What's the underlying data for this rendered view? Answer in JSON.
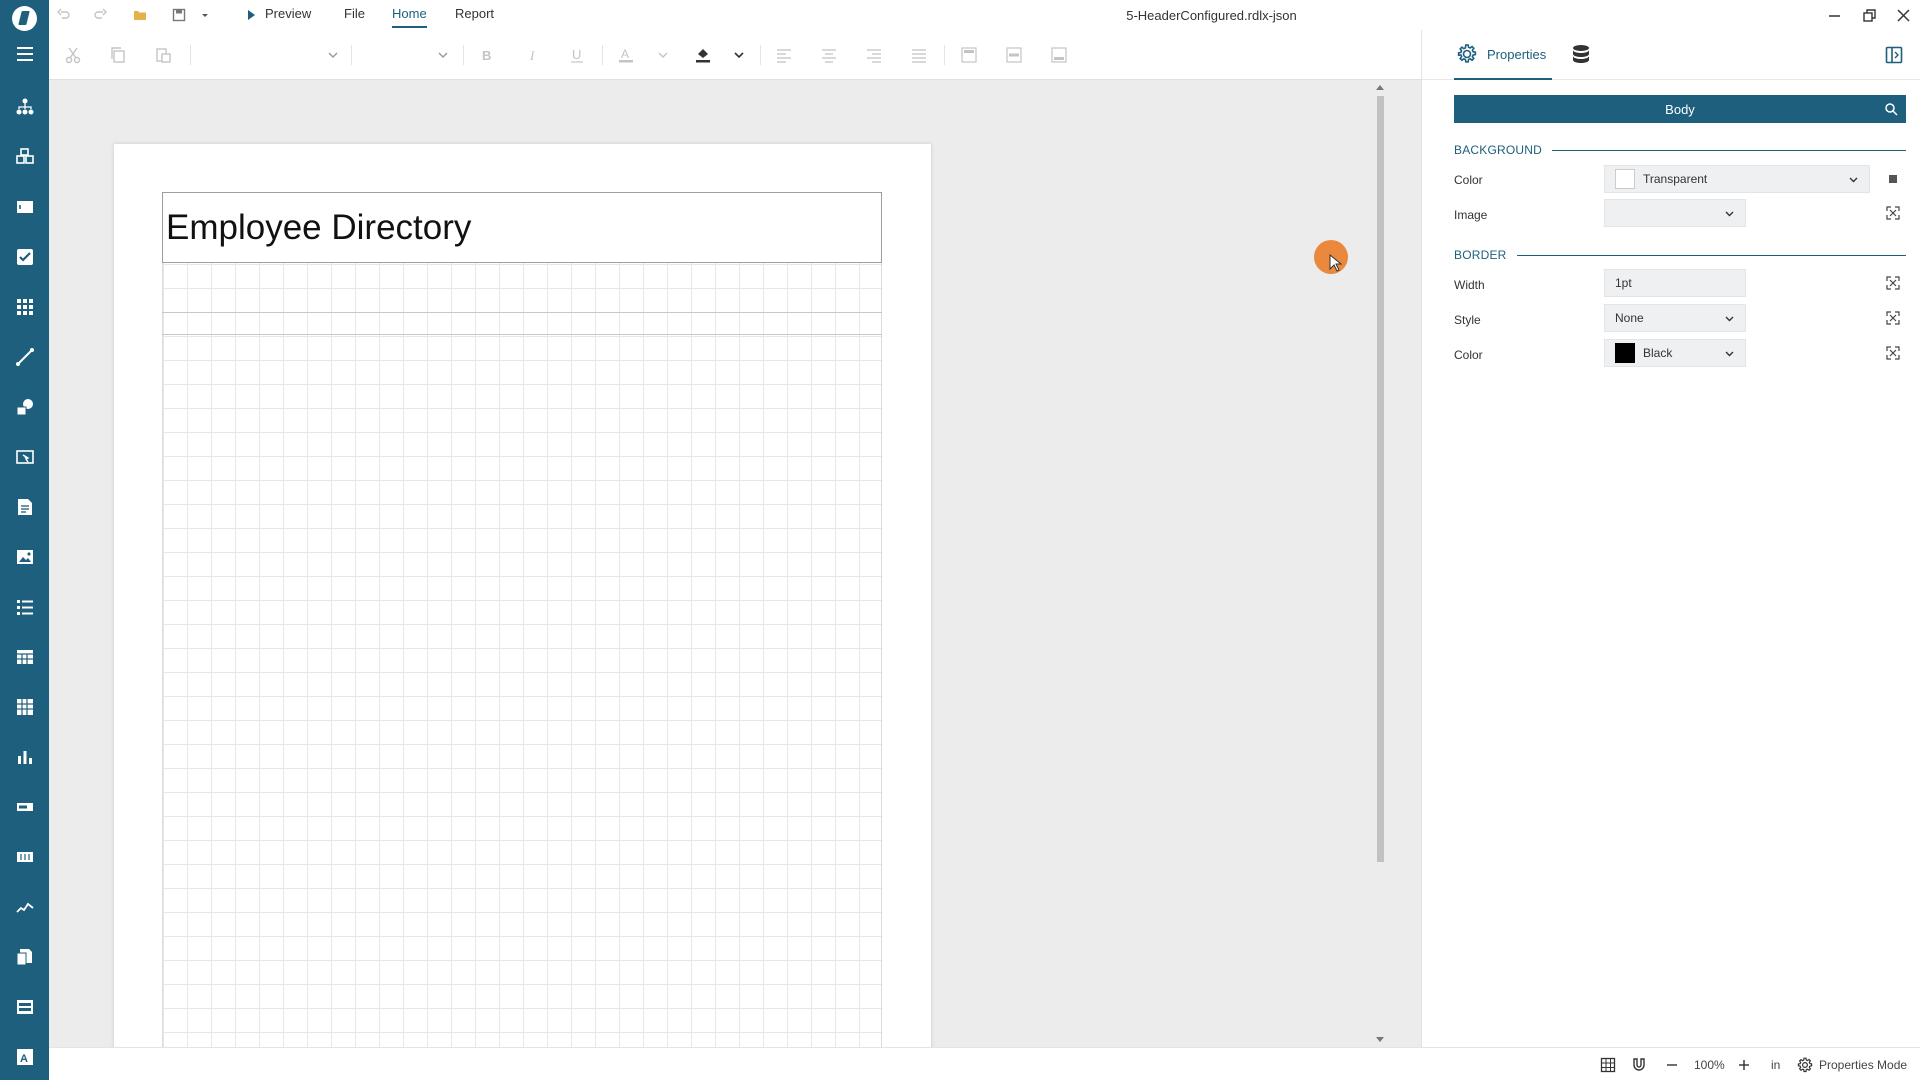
{
  "app": {
    "document_title": "5-HeaderConfigured.rdlx-json"
  },
  "menu": {
    "preview": "Preview",
    "file": "File",
    "home": "Home",
    "report": "Report"
  },
  "report": {
    "header_text": "Employee Directory"
  },
  "panel": {
    "properties_tab": "Properties",
    "selected_item": "Body",
    "sections": {
      "background": "BACKGROUND",
      "border": "BORDER"
    },
    "properties": {
      "bg_color_label": "Color",
      "bg_color_value": "Transparent",
      "bg_image_label": "Image",
      "bg_image_value": "",
      "border_width_label": "Width",
      "border_width_value": "1pt",
      "border_style_label": "Style",
      "border_style_value": "None",
      "border_color_label": "Color",
      "border_color_value": "Black"
    }
  },
  "status": {
    "zoom": "100%",
    "unit": "in",
    "mode": "Properties Mode"
  },
  "colors": {
    "accent": "#1d5f7d",
    "border_color_swatch": "#000000",
    "cursor_highlight": "#ea781e"
  }
}
